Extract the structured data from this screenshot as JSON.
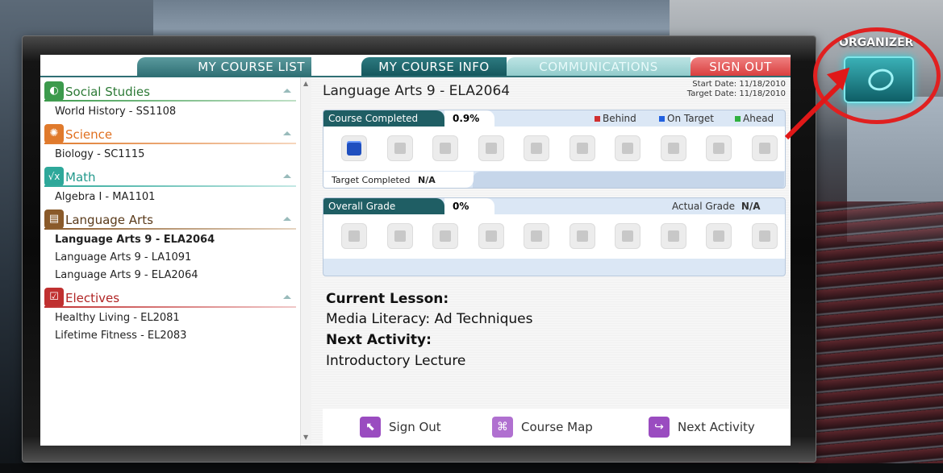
{
  "tabs": {
    "course_list": "MY COURSE LIST",
    "course_info": "MY COURSE INFO",
    "communications": "COMMUNICATIONS",
    "sign_out": "SIGN OUT"
  },
  "sidebar": {
    "categories": [
      {
        "label": "Social Studies",
        "icon": "globe-icon",
        "courses": [
          "World History - SS1108"
        ]
      },
      {
        "label": "Science",
        "icon": "atom-icon",
        "courses": [
          "Biology - SC1115"
        ]
      },
      {
        "label": "Math",
        "icon": "sqrt-icon",
        "courses": [
          "Algebra I - MA1101"
        ]
      },
      {
        "label": "Language Arts",
        "icon": "book-icon",
        "courses": [
          "Language Arts 9 - ELA2064",
          "Language Arts 9 - LA1091",
          "Language Arts 9 - ELA2064"
        ]
      },
      {
        "label": "Electives",
        "icon": "checkbox-icon",
        "courses": [
          "Healthy Living - EL2081",
          "Lifetime Fitness - EL2083"
        ]
      }
    ]
  },
  "main": {
    "course_title": "Language Arts 9 - ELA2064",
    "start_date": "Start Date: 11/18/2010",
    "target_date": "Target Date: 11/18/2010",
    "progress": {
      "label": "Course Completed",
      "value": "0.9%",
      "legend": [
        "Behind",
        "On Target",
        "Ahead"
      ],
      "legend_colors": [
        "#d03030",
        "#2060e0",
        "#30b040"
      ],
      "blocks_total": 10,
      "blocks_filled": 1,
      "target_label": "Target Completed",
      "target_value": "N/A"
    },
    "grade": {
      "label": "Overall Grade",
      "value": "0%",
      "actual_label": "Actual Grade",
      "actual_value": "N/A",
      "blocks_total": 10,
      "blocks_filled": 0
    },
    "current_lesson_label": "Current Lesson:",
    "current_lesson": "Media Literacy: Ad Techniques",
    "next_activity_label": "Next Activity:",
    "next_activity": "Introductory Lecture"
  },
  "bottom": {
    "sign_out": "Sign Out",
    "course_map": "Course Map",
    "next_activity": "Next Activity"
  },
  "organizer": {
    "label": "ORGANIZER"
  }
}
